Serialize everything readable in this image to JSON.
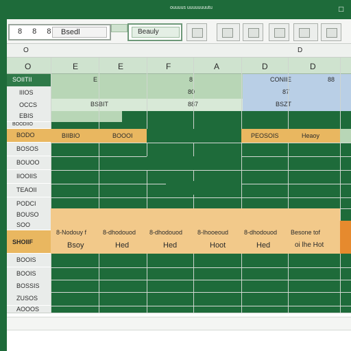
{
  "titlebar": {
    "text": "ouuuus uuuuuuuutu",
    "window_button": "□"
  },
  "ribbon": {
    "namebox_label": "8 8 8",
    "name_value": "Bsedl",
    "formula_value": "Beauly",
    "button_icons": [
      "ribbon-sort-icon",
      "ribbon-table-icon",
      "ribbon-chart-icon",
      "ribbon-format-icon",
      "ribbon-filter-icon",
      "ribbon-grid-icon"
    ]
  },
  "row_marker": {
    "left": "O",
    "right": "D"
  },
  "columns": [
    "O",
    "E",
    "E",
    "F",
    "A",
    "D",
    "D"
  ],
  "header_block": {
    "label": "SOIITII",
    "sub_left": "E",
    "sub_mid": "8",
    "sub_right": "CONIIE",
    "sub_far": "88",
    "row2_mid": "80",
    "row2_right": "87",
    "row3_left": "BSBIT",
    "row3_mid": "887",
    "row3_right": "BSZT"
  },
  "row_labels": [
    "IIIOS",
    "OCCS",
    "EBIS",
    "BOODIIO",
    "BODO",
    "BOSOS",
    "BOUOO",
    "IIOOIIS",
    "TEAOII",
    "PODCI",
    "BOUSO",
    "BOSOS",
    "SOO",
    "SHOIIF",
    "BOOIS",
    "BOOIS",
    "BOSSIS",
    "ZUSOS",
    "AOOOS"
  ],
  "highlight_row": {
    "col1": "BIIBIO",
    "col2": "BOOOI",
    "col5": "PEOSOIS",
    "col6": "Heaoy"
  },
  "orange_block": {
    "r1": [
      "8-Nodouy f",
      "8-dhodouod",
      "8-dhodouod",
      "8-lhooeoud",
      "8-dhodouod",
      "Besone tof"
    ],
    "r2": [
      "Bsoy",
      "Hed",
      "Hed",
      "Hoot",
      "Hed",
      "oi lhe Hot"
    ]
  },
  "colors": {
    "excel_green": "#1e6b3a",
    "header_orange": "#e9b760",
    "light_green": "#b8d6b6",
    "light_blue": "#b9cfe6",
    "orange_fill": "#f2c98a"
  }
}
